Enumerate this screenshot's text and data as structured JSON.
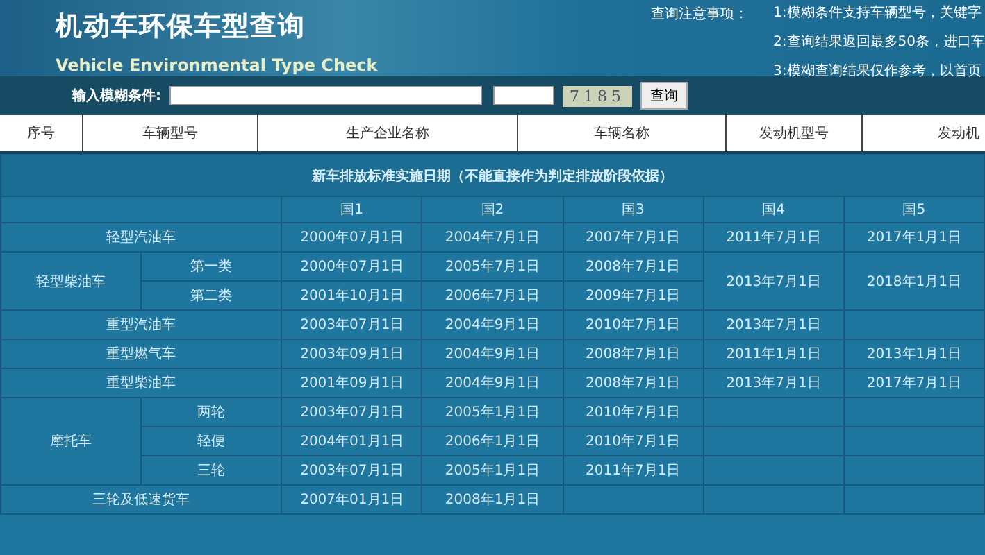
{
  "header": {
    "title": "机动车环保车型查询",
    "subtitle": "Vehicle Environmental Type Check",
    "notes_title": "查询注意事项：",
    "notes": [
      "1:模糊条件支持车辆型号，关键字",
      "2:查询结果返回最多50条，进口车",
      "3:模糊查询结果仅作参考，以首页"
    ]
  },
  "search": {
    "label": "输入模糊条件:",
    "captcha": "7185",
    "button": "查询"
  },
  "result_columns": [
    "序号",
    "车辆型号",
    "生产企业名称",
    "车辆名称",
    "发动机型号",
    "发动机"
  ],
  "standards": {
    "caption": "新车排放标准实施日期（不能直接作为判定排放阶段依据）",
    "columns": [
      "国1",
      "国2",
      "国3",
      "国4",
      "国5"
    ],
    "groups": [
      {
        "label": "轻型汽油车",
        "dates": [
          "2000年07月1日",
          "2004年7月1日",
          "2007年7月1日",
          "2011年7月1日",
          "2017年1月1日"
        ]
      },
      {
        "label": "轻型柴油车",
        "subrows": [
          {
            "label": "第一类",
            "dates": [
              "2000年07月1日",
              "2005年7月1日",
              "2008年7月1日"
            ]
          },
          {
            "label": "第二类",
            "dates": [
              "2001年10月1日",
              "2006年7月1日",
              "2009年7月1日"
            ]
          }
        ],
        "shared_dates": [
          "2013年7月1日",
          "2018年1月1日"
        ]
      },
      {
        "label": "重型汽油车",
        "dates": [
          "2003年07月1日",
          "2004年9月1日",
          "2010年7月1日",
          "2013年7月1日"
        ]
      },
      {
        "label": "重型燃气车",
        "dates": [
          "2003年09月1日",
          "2004年9月1日",
          "2008年7月1日",
          "2011年1月1日",
          "2013年1月1日"
        ]
      },
      {
        "label": "重型柴油车",
        "dates": [
          "2001年09月1日",
          "2004年9月1日",
          "2008年7月1日",
          "2013年7月1日",
          "2017年7月1日"
        ]
      },
      {
        "label": "摩托车",
        "subrows": [
          {
            "label": "两轮",
            "dates": [
              "2003年07月1日",
              "2005年1月1日",
              "2010年7月1日"
            ]
          },
          {
            "label": "轻便",
            "dates": [
              "2004年01月1日",
              "2006年1月1日",
              "2010年7月1日"
            ]
          },
          {
            "label": "三轮",
            "dates": [
              "2003年07月1日",
              "2005年1月1日",
              "2011年7月1日"
            ]
          }
        ]
      },
      {
        "label": "三轮及低速货车",
        "dates": [
          "2007年01月1日",
          "2008年1月1日"
        ]
      }
    ]
  }
}
